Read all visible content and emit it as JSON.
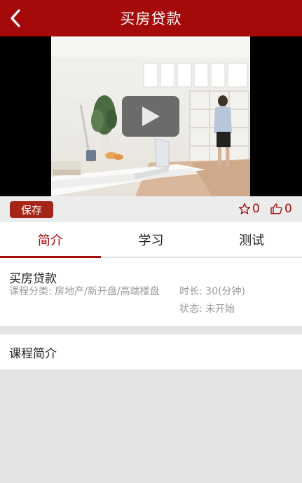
{
  "header": {
    "title": "买房贷款",
    "back_icon": "chevron-left-icon"
  },
  "video": {
    "play_icon": "play-icon"
  },
  "actions": {
    "save_label": "保存",
    "favorite_count": "0",
    "like_count": "0",
    "favorite_icon": "star-outline-icon",
    "like_icon": "thumbs-up-outline-icon"
  },
  "tabs": [
    {
      "label": "简介",
      "active": true
    },
    {
      "label": "学习",
      "active": false
    },
    {
      "label": "测试",
      "active": false
    }
  ],
  "course": {
    "name": "买房贷款",
    "category_label": "课程分类:",
    "category": "房地产/新开盘/高端楼盘",
    "duration_label": "时长:",
    "duration": "30(分钟)",
    "status_label": "状态:",
    "status": "未开始"
  },
  "intro": {
    "title": "课程简介"
  },
  "colors": {
    "brand": "#a50a0a",
    "muted_text": "#999999",
    "background": "#e4e4e4"
  }
}
